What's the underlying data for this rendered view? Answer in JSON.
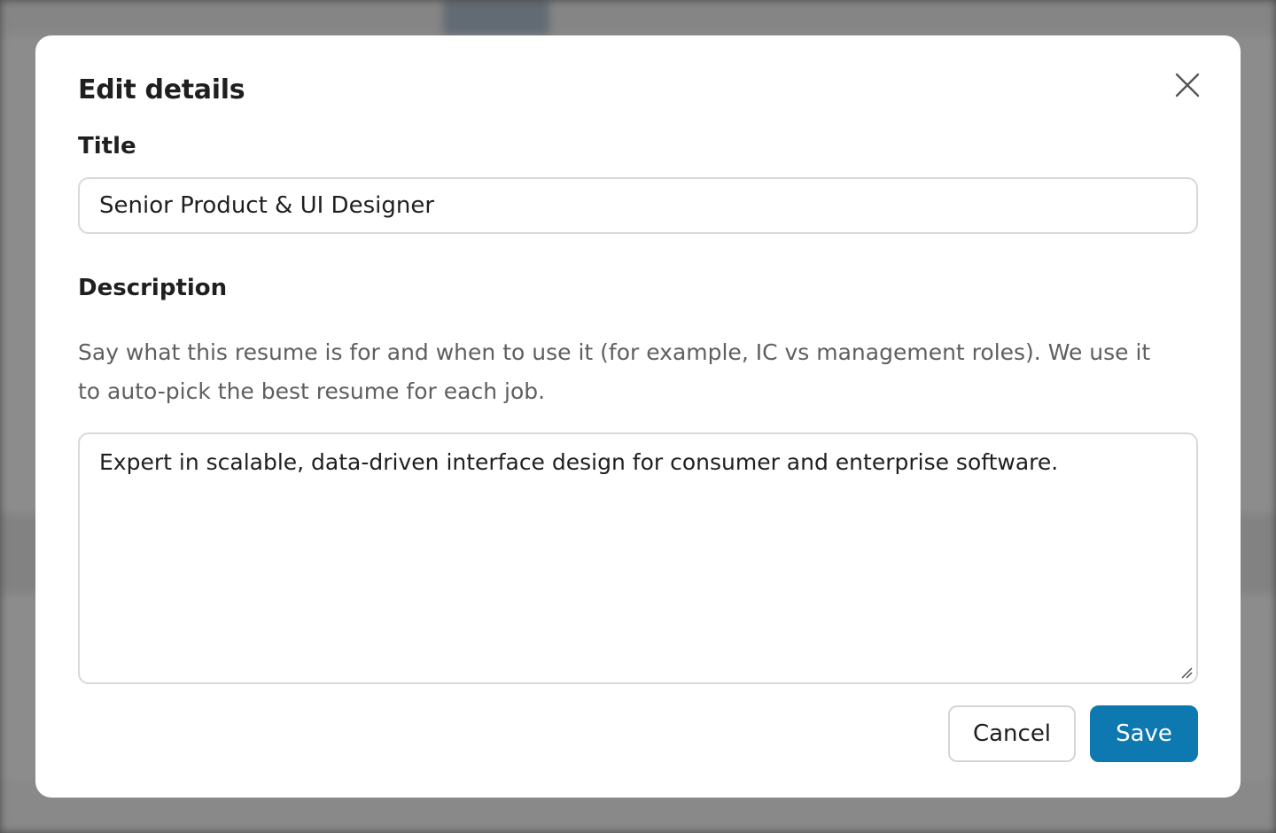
{
  "modal": {
    "title": "Edit details",
    "close_label": "Close",
    "title_field": {
      "label": "Title",
      "value": "Senior Product & UI Designer"
    },
    "description_field": {
      "label": "Description",
      "helper": "Say what this resume is for and when to use it (for example, IC vs management roles). We use it to auto-pick the best resume for each job.",
      "value": "Expert in scalable, data-driven interface design for consumer and enterprise software."
    },
    "actions": {
      "cancel_label": "Cancel",
      "save_label": "Save"
    }
  },
  "colors": {
    "primary": "#0e78b0",
    "overlay": "rgba(0,0,0,0.42)"
  },
  "icons": {
    "close": "close-icon",
    "resize": "resize-handle-icon"
  }
}
